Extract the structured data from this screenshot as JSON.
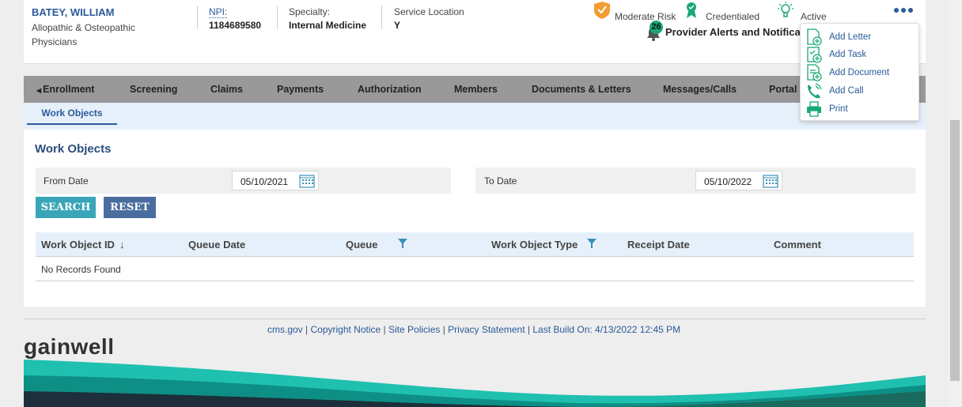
{
  "provider": {
    "name": "BATEY, WILLIAM",
    "type": "Allopathic & Osteopathic Physicians",
    "npi_label": "NPI:",
    "npi_value": "1184689580",
    "specialty_label": "Specialty:",
    "specialty_value": "Internal Medicine",
    "service_location_label": "Service Location",
    "service_location_value": "Y"
  },
  "status": {
    "risk": "Moderate Risk",
    "credential": "Credentialed",
    "active": "Active"
  },
  "alerts": {
    "count": "26",
    "title": "Provider Alerts and Notificat"
  },
  "nav": {
    "items": [
      "Enrollment",
      "Screening",
      "Claims",
      "Payments",
      "Authorization",
      "Members",
      "Documents & Letters",
      "Messages/Calls",
      "Portal"
    ]
  },
  "subnav": {
    "active_tab": "Work Objects"
  },
  "main": {
    "title": "Work Objects",
    "from_date_label": "From Date",
    "from_date_value": "05/10/2021",
    "to_date_label": "To Date",
    "to_date_value": "05/10/2022",
    "search_label": "SEARCH",
    "reset_label": "RESET"
  },
  "table": {
    "columns": [
      "Work Object ID",
      "Queue Date",
      "Queue",
      "Work Object Type",
      "Receipt Date",
      "Comment"
    ],
    "empty_text": "No Records Found"
  },
  "footer": {
    "links": [
      "cms.gov",
      "Copyright Notice",
      "Site Policies",
      "Privacy Statement",
      "Last Build On: 4/13/2022 12:45 PM"
    ],
    "logo": "gainwell"
  },
  "menu": {
    "items": [
      "Add Letter",
      "Add Task",
      "Add Document",
      "Add Call",
      "Print"
    ]
  },
  "colors": {
    "accent": "#2a5a9a",
    "nav_bg": "#999999",
    "teal": "#19a974",
    "search_btn": "#3aa5b8",
    "reset_btn": "#4a6da0"
  }
}
